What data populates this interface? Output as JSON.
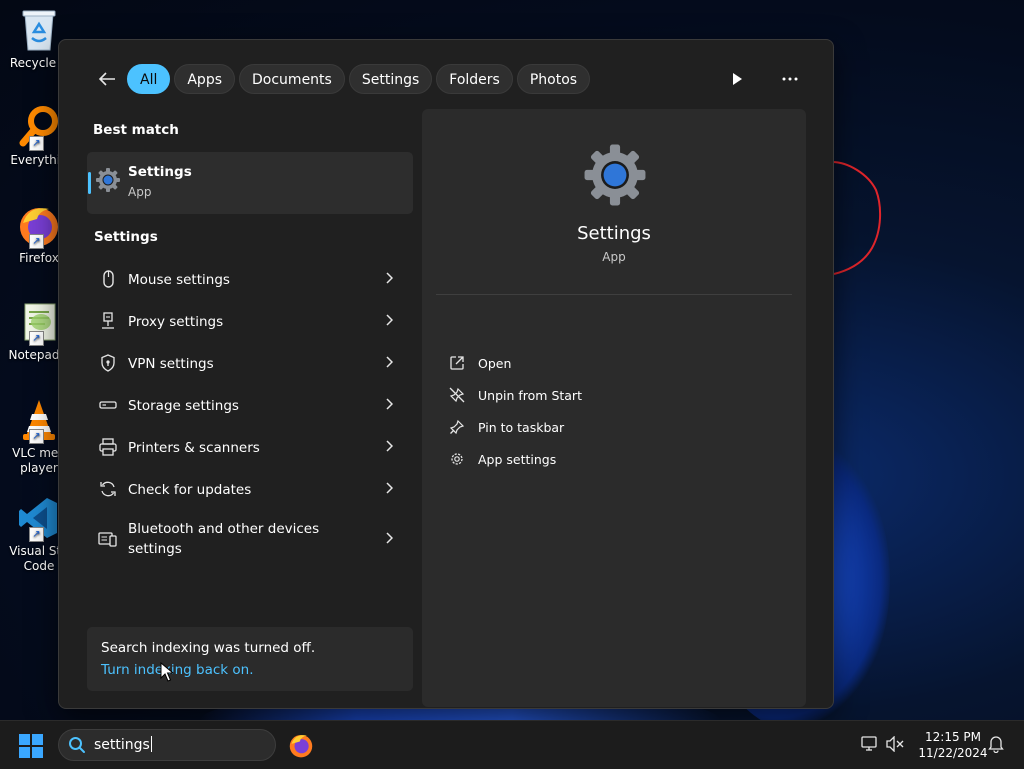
{
  "desktop": {
    "icons": [
      {
        "label": "Recycle B",
        "icon": "recycle-bin-icon"
      },
      {
        "label": "Everythin",
        "icon": "everything-search-icon"
      },
      {
        "label": "Firefox",
        "icon": "firefox-icon"
      },
      {
        "label": "Notepad+",
        "icon": "notepad-plus-plus-icon"
      },
      {
        "label": "VLC med\nplayer",
        "icon": "vlc-icon"
      },
      {
        "label": "Visual Stu\nCode",
        "icon": "vscode-icon"
      }
    ]
  },
  "search_panel": {
    "filters": [
      "All",
      "Apps",
      "Documents",
      "Settings",
      "Folders",
      "Photos"
    ],
    "active_filter": "All",
    "best_match": {
      "heading": "Best match",
      "title": "Settings",
      "subtitle": "App"
    },
    "settings_section": {
      "heading": "Settings",
      "items": [
        {
          "label": "Mouse settings",
          "icon": "mouse-icon"
        },
        {
          "label": "Proxy settings",
          "icon": "proxy-icon"
        },
        {
          "label": "VPN settings",
          "icon": "shield-icon"
        },
        {
          "label": "Storage settings",
          "icon": "storage-icon"
        },
        {
          "label": "Printers & scanners",
          "icon": "printer-icon"
        },
        {
          "label": "Check for updates",
          "icon": "sync-icon"
        },
        {
          "label": "Bluetooth and other devices settings",
          "icon": "devices-icon"
        }
      ]
    },
    "notice": {
      "text": "Search indexing was turned off.",
      "link": "Turn indexing back on."
    },
    "detail": {
      "title": "Settings",
      "subtitle": "App",
      "actions": [
        {
          "label": "Open",
          "icon": "open-external-icon"
        },
        {
          "label": "Unpin from Start",
          "icon": "unpin-icon"
        },
        {
          "label": "Pin to taskbar",
          "icon": "pin-icon"
        },
        {
          "label": "App settings",
          "icon": "gear-icon"
        }
      ]
    }
  },
  "taskbar": {
    "search_value": "settings",
    "time": "12:15 PM",
    "date": "11/22/2024"
  },
  "colors": {
    "accent": "#4cc2ff",
    "panel_bg": "#202020",
    "annotation": "#e0252b"
  }
}
